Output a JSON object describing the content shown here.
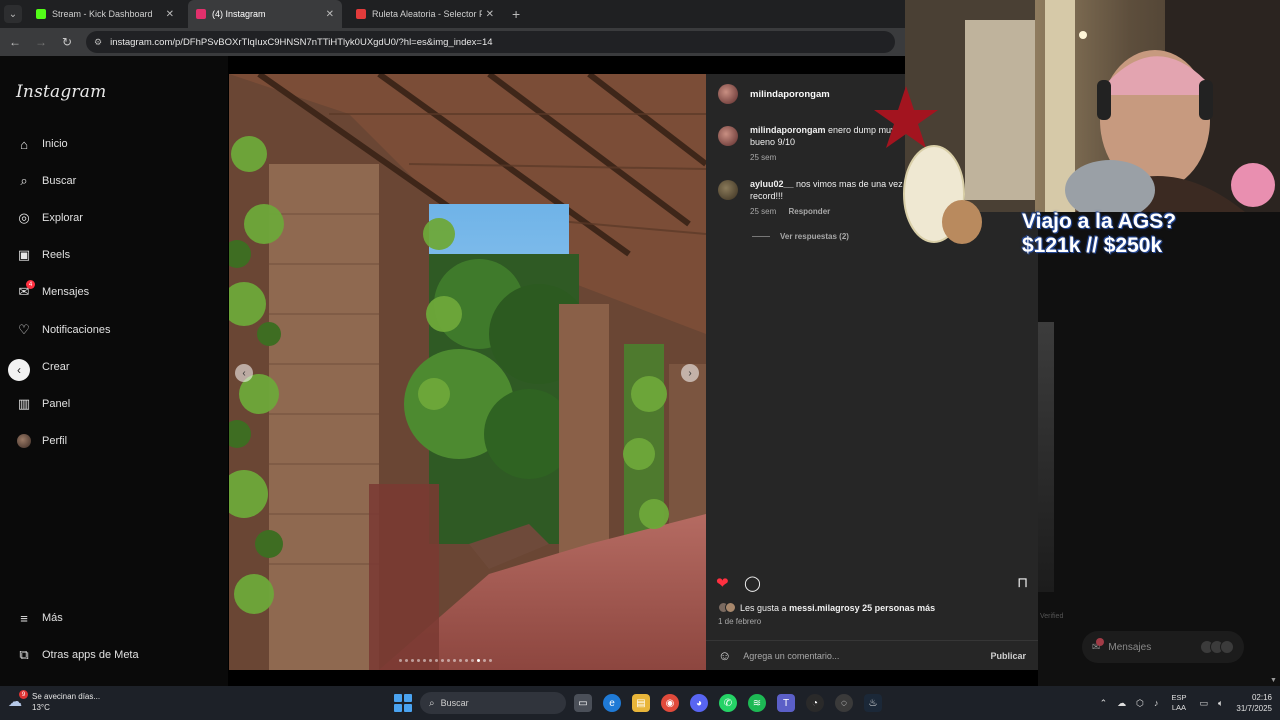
{
  "browser": {
    "tabs": [
      {
        "title": "Stream - Kick Dashboard",
        "favicon_color": "#53fc18",
        "active": false
      },
      {
        "title": "(4) Instagram",
        "favicon_color": "#e1306c",
        "active": true
      },
      {
        "title": "Ruleta Aleatoria - Selector Pers",
        "favicon_color": "#e23b3b",
        "active": false
      }
    ],
    "url": "instagram.com/p/DFhPSvBOXrTlqIuxC9HNSN7nTTiHTlyk0UXgdU0/?hl=es&img_index=14"
  },
  "instagram": {
    "logo": "Instagram",
    "nav": [
      {
        "label": "Inicio",
        "icon": "home-icon",
        "glyph": "⌂"
      },
      {
        "label": "Buscar",
        "icon": "search-icon",
        "glyph": "⌕"
      },
      {
        "label": "Explorar",
        "icon": "compass-icon",
        "glyph": "◎"
      },
      {
        "label": "Reels",
        "icon": "reels-icon",
        "glyph": "▣"
      },
      {
        "label": "Mensajes",
        "icon": "messenger-icon",
        "glyph": "✉",
        "badge": "4"
      },
      {
        "label": "Notificaciones",
        "icon": "heart-icon",
        "glyph": "♡"
      },
      {
        "label": "Crear",
        "icon": "create-icon",
        "glyph": "⊕"
      },
      {
        "label": "Panel",
        "icon": "panel-icon",
        "glyph": "▥"
      },
      {
        "label": "Perfil",
        "icon": "profile-avatar",
        "glyph": ""
      }
    ],
    "more": {
      "label": "Más",
      "glyph": "≡"
    },
    "meta_apps": {
      "label": "Otras apps de Meta",
      "glyph": "⧉"
    }
  },
  "post": {
    "author": "milindaporongam",
    "comments": [
      {
        "user": "milindaporongam",
        "text": "enero dump muy bueno 9/10",
        "time": "25 sem",
        "reply": ""
      },
      {
        "user": "ayluu02__",
        "text": "nos vimos mas de una vez record!!!",
        "time": "25 sem",
        "reply": "Responder"
      }
    ],
    "view_replies": "Ver respuestas (2)",
    "likes_text_prefix": "Les gusta a ",
    "likes_user": "messi.milagros",
    "likes_text_suffix": " y 25 personas más",
    "date": "1 de febrero",
    "comment_placeholder": "Agrega un comentario...",
    "publish_label": "Publicar",
    "colors": {
      "like": "#ff3040"
    }
  },
  "background": {
    "verified": "Verified",
    "messages_pill": "Mensajes",
    "messages_badge": "4"
  },
  "stream_overlay": {
    "line1": "Viajo a la AGS?",
    "line2": "$121k // $250k"
  },
  "taskbar": {
    "weather_title": "Se avecinan días...",
    "weather_temp": "13°C",
    "weather_badge": "9",
    "search_label": "Buscar",
    "lang_line1": "ESP",
    "lang_line2": "LAA",
    "time": "02:16",
    "date": "31/7/2025"
  }
}
